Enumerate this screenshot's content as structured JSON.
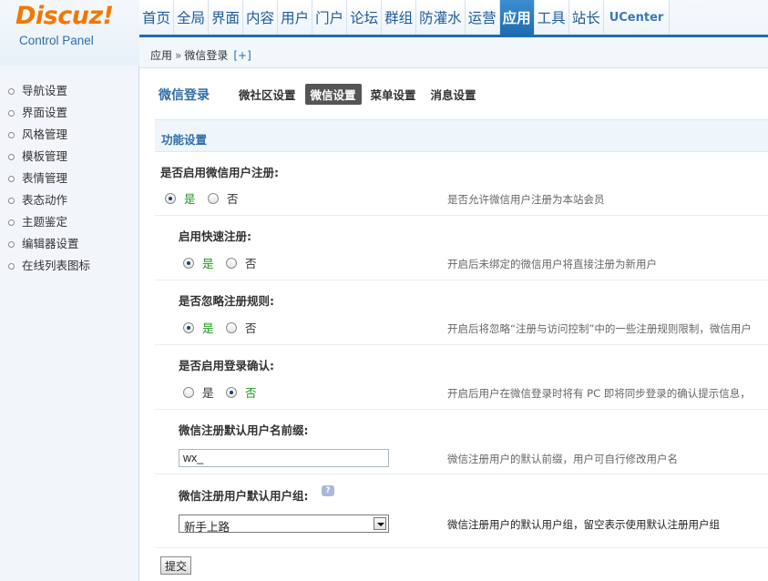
{
  "logo": {
    "brand": "Discuz!",
    "subtitle": "Control Panel"
  },
  "nav": {
    "items": [
      {
        "label": "首页"
      },
      {
        "label": "全局"
      },
      {
        "label": "界面"
      },
      {
        "label": "内容"
      },
      {
        "label": "用户"
      },
      {
        "label": "门户"
      },
      {
        "label": "论坛"
      },
      {
        "label": "群组"
      },
      {
        "label": "防灌水"
      },
      {
        "label": "运营"
      },
      {
        "label": "应用"
      },
      {
        "label": "工具"
      },
      {
        "label": "站长"
      },
      {
        "label": "UCenter"
      }
    ],
    "active": "应用"
  },
  "breadcrumb": {
    "parent": "应用",
    "separator": "»",
    "current": "微信登录",
    "add": "[+]"
  },
  "sidebar": {
    "items": [
      {
        "label": "导航设置"
      },
      {
        "label": "界面设置"
      },
      {
        "label": "风格管理"
      },
      {
        "label": "模板管理"
      },
      {
        "label": "表情管理"
      },
      {
        "label": "表态动作"
      },
      {
        "label": "主题鉴定"
      },
      {
        "label": "编辑器设置"
      },
      {
        "label": "在线列表图标"
      }
    ]
  },
  "tabs": {
    "title": "微信登录",
    "items": [
      {
        "label": "微社区设置"
      },
      {
        "label": "微信设置"
      },
      {
        "label": "菜单设置"
      },
      {
        "label": "消息设置"
      }
    ],
    "active": "微信设置"
  },
  "section": {
    "title": "功能设置"
  },
  "settings": {
    "register": {
      "label": "是否启用微信用户注册:",
      "yes": "是",
      "no": "否",
      "value": "yes",
      "tip": "是否允许微信用户注册为本站会员"
    },
    "quick_register": {
      "label": "启用快速注册:",
      "yes": "是",
      "no": "否",
      "value": "yes",
      "tip": "开启后未绑定的微信用户将直接注册为新用户"
    },
    "ignore_rules": {
      "label": "是否忽略注册规则:",
      "yes": "是",
      "no": "否",
      "value": "yes",
      "tip": "开启后将忽略“注册与访问控制”中的一些注册规则限制，微信用户"
    },
    "login_confirm": {
      "label": "是否启用登录确认:",
      "yes": "是",
      "no": "否",
      "value": "no",
      "tip": "开启后用户在微信登录时将有 PC 即将同步登录的确认提示信息，"
    },
    "username_prefix": {
      "label": "微信注册默认用户名前缀:",
      "value": "wx_",
      "tip": "微信注册用户的默认前缀，用户可自行修改用户名"
    },
    "default_group": {
      "label": "微信注册用户默认用户组:",
      "help": "?",
      "value": "新手上路",
      "tip": "微信注册用户的默认用户组，留空表示使用默认注册用户组"
    }
  },
  "submit_label": "提交"
}
